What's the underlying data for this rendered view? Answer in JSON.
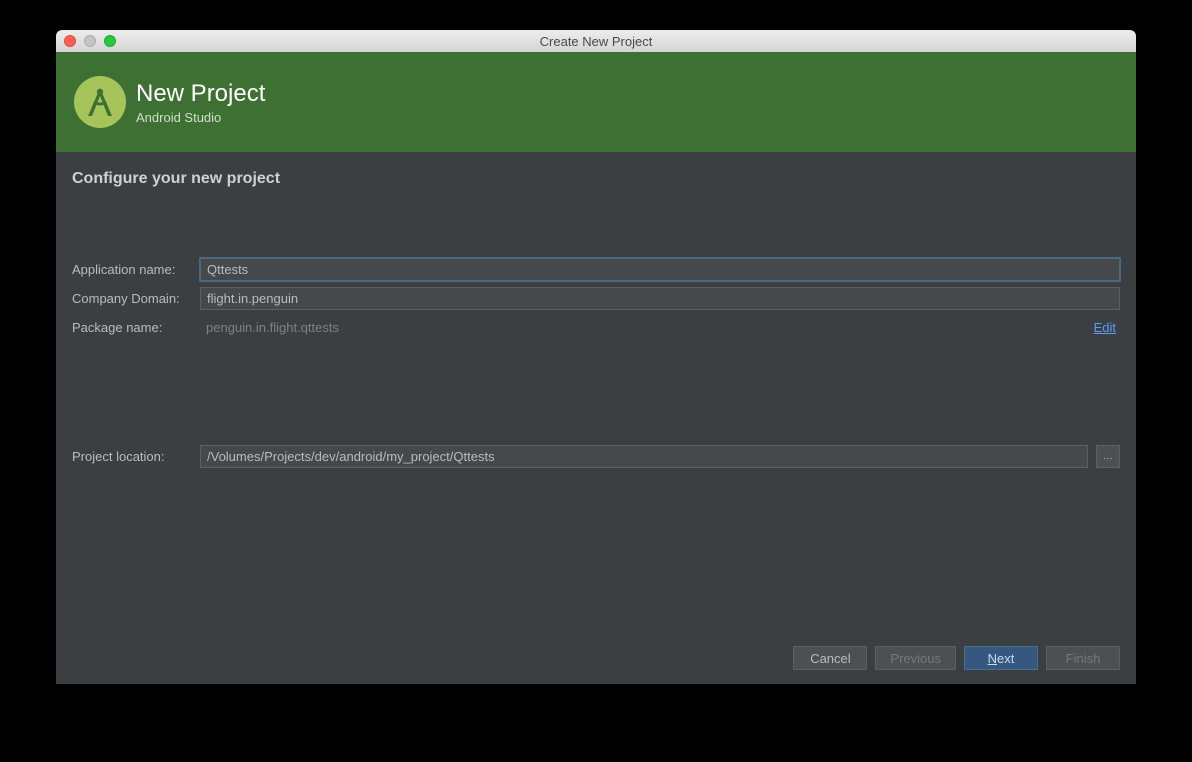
{
  "window": {
    "title": "Create New Project"
  },
  "header": {
    "title": "New Project",
    "subtitle": "Android Studio"
  },
  "section": {
    "title": "Configure your new project"
  },
  "form": {
    "app_name_label": "Application name:",
    "app_name_value": "Qttests",
    "company_label": "Company Domain:",
    "company_value": "flight.in.penguin",
    "package_label": "Package name:",
    "package_value": "penguin.in.flight.qttests",
    "edit_link": "Edit",
    "location_label": "Project location:",
    "location_value": "/Volumes/Projects/dev/android/my_project/Qttests",
    "browse_glyph": "…"
  },
  "footer": {
    "cancel": "Cancel",
    "previous": "Previous",
    "next_mnemonic": "N",
    "next_rest": "ext",
    "finish": "Finish"
  }
}
